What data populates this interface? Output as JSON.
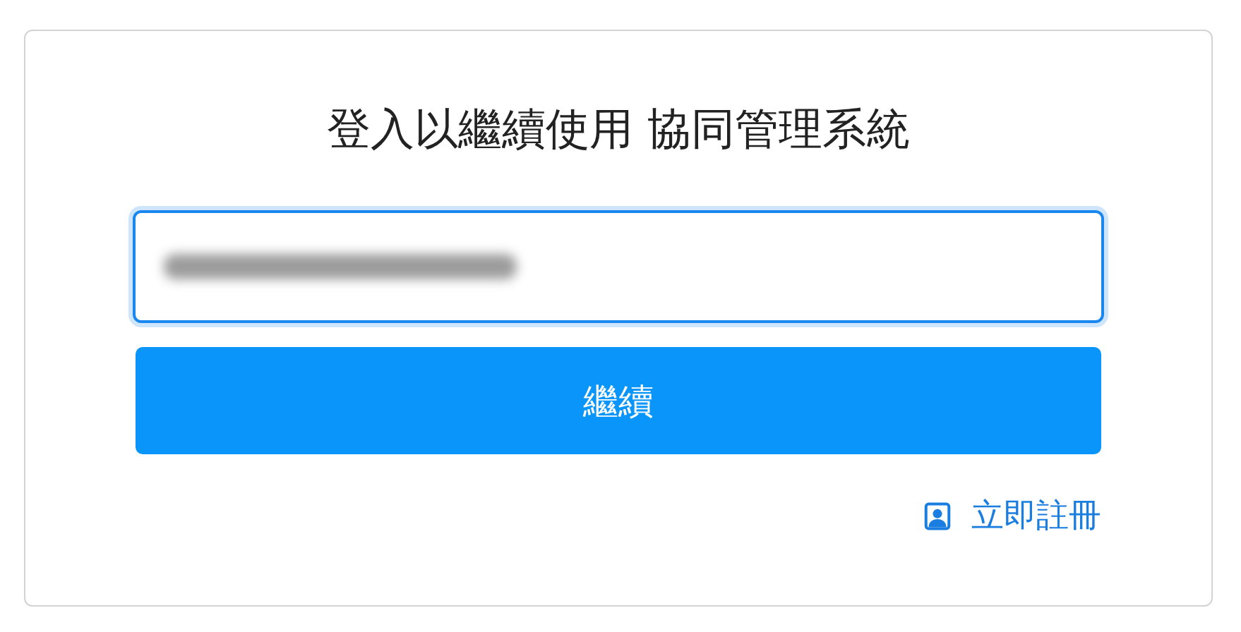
{
  "title": "登入以繼續使用 協同管理系統",
  "email_field": {
    "focused": true,
    "redacted": true
  },
  "continue_button": {
    "label": "繼續"
  },
  "register_link": {
    "label": "立即註冊"
  }
}
